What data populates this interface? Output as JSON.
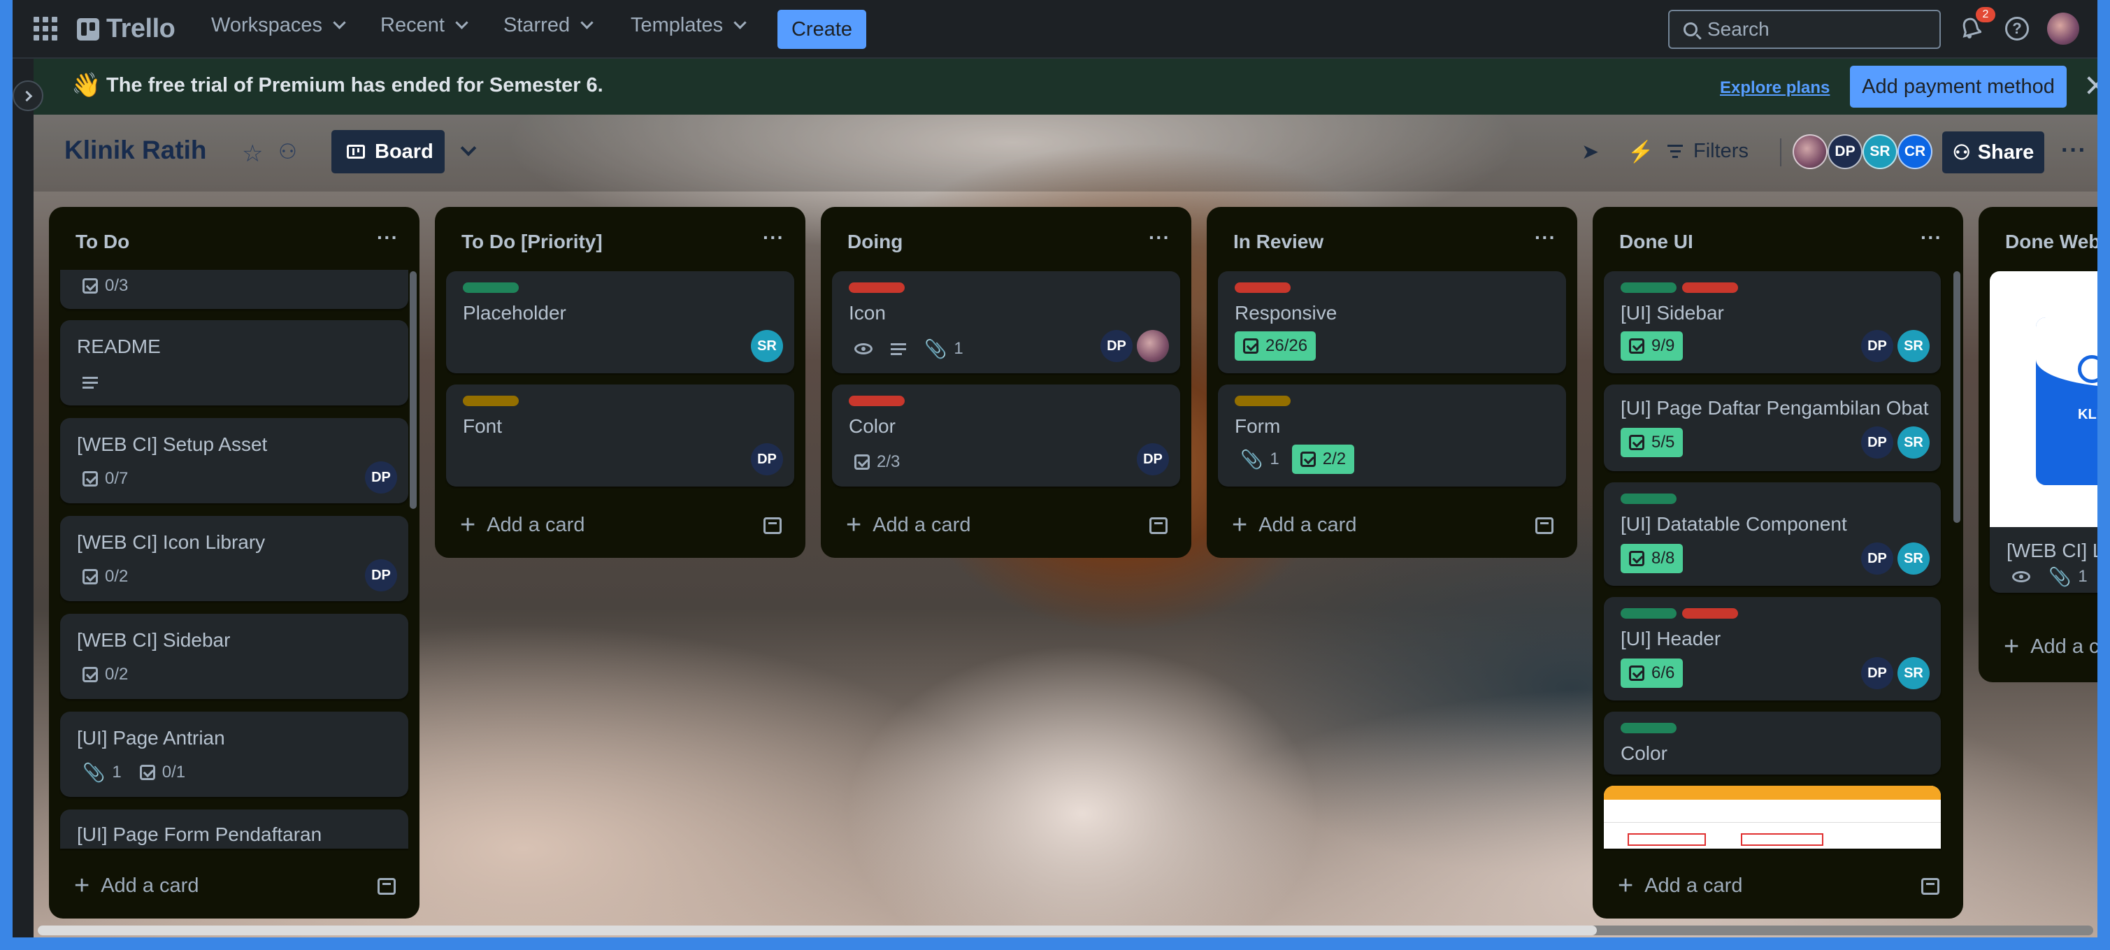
{
  "nav": {
    "logo": "Trello",
    "menus": [
      "Workspaces",
      "Recent",
      "Starred",
      "Templates"
    ],
    "create": "Create",
    "search_placeholder": "Search",
    "notification_count": "2"
  },
  "banner": {
    "emoji": "👋",
    "text": "The free trial of Premium has ended for Semester 6.",
    "explore": "Explore plans",
    "payment": "Add payment method"
  },
  "board": {
    "title": "Klinik Ratih",
    "view": "Board",
    "filters": "Filters",
    "members": [
      "DP",
      "SR",
      "CR"
    ],
    "share": "Share"
  },
  "lists": [
    {
      "title": "To Do",
      "cards": [
        {
          "title": "",
          "checklist": "0/3"
        },
        {
          "title": "README",
          "description": true
        },
        {
          "title": "[WEB CI] Setup Asset",
          "checklist": "0/7",
          "members": [
            "DP"
          ]
        },
        {
          "title": "[WEB CI] Icon Library",
          "checklist": "0/2",
          "members": [
            "DP"
          ]
        },
        {
          "title": "[WEB CI] Sidebar",
          "checklist": "0/2"
        },
        {
          "title": "[UI] Page Antrian",
          "attachments": "1",
          "checklist": "0/1"
        },
        {
          "title": "[UI] Page Form Pendaftaran"
        }
      ],
      "add": "Add a card"
    },
    {
      "title": "To Do [Priority]",
      "cards": [
        {
          "title": "Placeholder",
          "label_color": "#1f845a",
          "members": [
            "SR"
          ]
        },
        {
          "title": "Font",
          "label_color": "#946f00",
          "members": [
            "DP"
          ]
        }
      ],
      "add": "Add a card"
    },
    {
      "title": "Doing",
      "cards": [
        {
          "title": "Icon",
          "label_color": "#c9372c",
          "attachments": "1",
          "members": [
            "DP"
          ]
        },
        {
          "title": "Color",
          "label_color": "#c9372c",
          "checklist": "2/3",
          "members": [
            "DP"
          ]
        }
      ],
      "add": "Add a card"
    },
    {
      "title": "In Review",
      "cards": [
        {
          "title": "Responsive",
          "label_color": "#c9372c",
          "checklist": "26/26"
        },
        {
          "title": "Form",
          "label_color": "#946f00",
          "attachments": "1",
          "checklist": "2/2"
        }
      ],
      "add": "Add a card"
    },
    {
      "title": "Done UI",
      "cards": [
        {
          "title": "[UI] Sidebar",
          "checklist": "9/9",
          "members": [
            "DP",
            "SR"
          ]
        },
        {
          "title": "[UI] Page Daftar Pengambilan Obat",
          "checklist": "5/5",
          "members": [
            "DP",
            "SR"
          ]
        },
        {
          "title": "[UI] Datatable Component",
          "checklist": "8/8",
          "members": [
            "DP",
            "SR"
          ]
        },
        {
          "title": "[UI] Header",
          "checklist": "6/6",
          "members": [
            "DP",
            "SR"
          ]
        },
        {
          "title": "Color"
        }
      ],
      "add": "Add a card"
    },
    {
      "title": "Done Web",
      "cards": [
        {
          "title": "[WEB CI] Lo",
          "attachments": "1",
          "cover_text": "KLI"
        }
      ],
      "add": "Add a c"
    }
  ],
  "colors": {
    "green_label": "#1f845a",
    "red_label": "#c9372c",
    "yellow_label": "#946f00",
    "done_badge": "#4bce97",
    "accent": "#579dff"
  }
}
